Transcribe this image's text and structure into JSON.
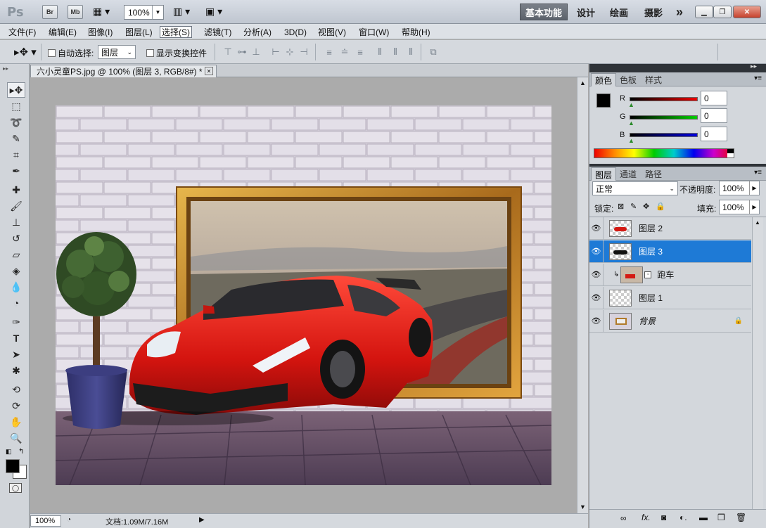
{
  "app": {
    "logo": "Ps",
    "br": "Br",
    "mb": "Mb",
    "zoom": "100%"
  },
  "workspaces": {
    "essentials": "基本功能",
    "design": "设计",
    "paint": "绘画",
    "photo": "摄影",
    "more": "»"
  },
  "menu": [
    "文件(F)",
    "编辑(E)",
    "图像(I)",
    "图层(L)",
    "选择(S)",
    "滤镜(T)",
    "分析(A)",
    "3D(D)",
    "视图(V)",
    "窗口(W)",
    "帮助(H)"
  ],
  "options": {
    "auto_select_label": "自动选择:",
    "auto_select_value": "图层",
    "show_transform_label": "显示变换控件"
  },
  "document": {
    "tab_title": "六小灵童PS.jpg @ 100% (图层 3, RGB/8#) *",
    "close": "✕"
  },
  "status": {
    "zoom": "100%",
    "doc_info": "文档:1.09M/7.16M"
  },
  "color_panel": {
    "tabs": [
      "颜色",
      "色板",
      "样式"
    ],
    "r_label": "R",
    "g_label": "G",
    "b_label": "B",
    "r": "0",
    "g": "0",
    "b": "0"
  },
  "layers_panel": {
    "tabs": [
      "图层",
      "通道",
      "路径"
    ],
    "blend_mode": "正常",
    "opacity_label": "不透明度:",
    "opacity": "100%",
    "lock_label": "锁定:",
    "fill_label": "填充:",
    "fill": "100%",
    "layers": [
      {
        "name": "图层 2",
        "selected": false
      },
      {
        "name": "图层 3",
        "selected": true
      },
      {
        "name": "跑车",
        "selected": false,
        "clipped": true
      },
      {
        "name": "图层 1",
        "selected": false
      },
      {
        "name": "背景",
        "selected": false,
        "locked": true
      }
    ]
  },
  "colors": {
    "accent": "#1e7ad6",
    "canvas_bg": "#ababab",
    "panel": "#d3d7dc"
  }
}
